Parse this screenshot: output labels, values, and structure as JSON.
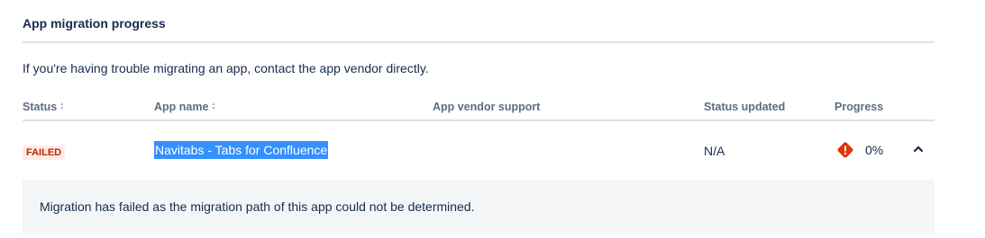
{
  "section": {
    "title": "App migration progress",
    "intro": "If you're having trouble migrating an app, contact the app vendor directly."
  },
  "table": {
    "headers": {
      "status": "Status",
      "app_name": "App name",
      "vendor_support": "App vendor support",
      "status_updated": "Status updated",
      "progress": "Progress"
    },
    "rows": [
      {
        "status": "FAILED",
        "app_name": "Navitabs - Tabs for Confluence",
        "vendor_support": "",
        "status_updated": "N/A",
        "progress_percent": "0%",
        "progress_icon": "error-warning-icon",
        "expanded": true,
        "detail": "Migration has failed as the migration path of this app could not be determined."
      }
    ]
  },
  "colors": {
    "failed_lozenge_bg": "#ffebe6",
    "failed_lozenge_text": "#bf2600",
    "error_icon": "#de350b",
    "selection": "#3390ff",
    "detail_bg": "#f4f5f7"
  }
}
